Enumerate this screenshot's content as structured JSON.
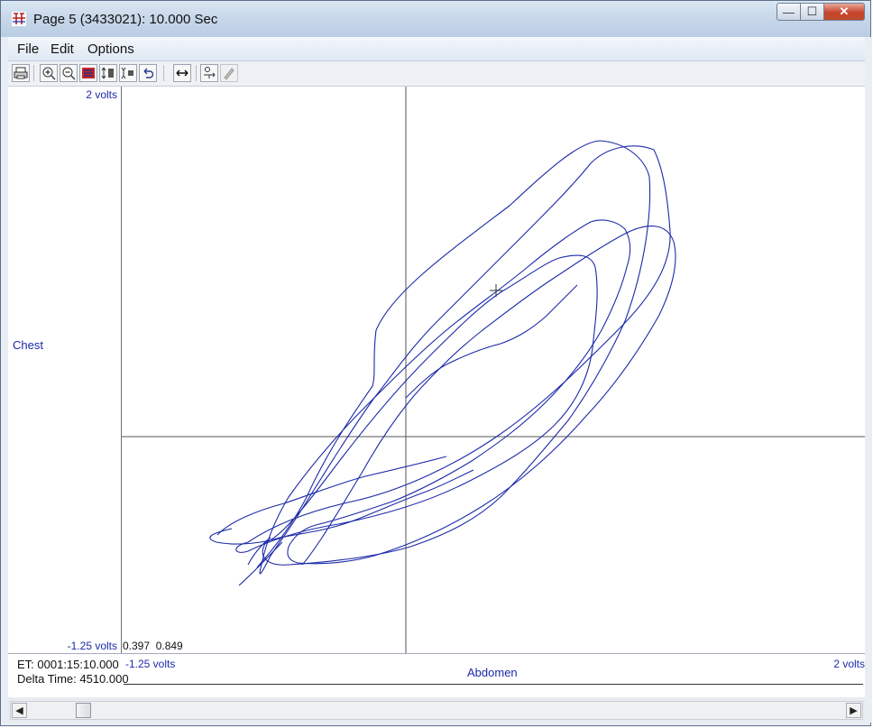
{
  "window": {
    "title": "Page 5 (3433021): 10.000 Sec",
    "min_glyph": "—",
    "max_glyph": "☐",
    "close_glyph": "✕"
  },
  "menu": {
    "file": "File",
    "edit": "Edit",
    "options": "Options"
  },
  "toolbar": {
    "buttons": [
      "print-icon",
      "zoom-in-icon",
      "zoom-out-icon",
      "highlight-icon",
      "expand-vertical-icon",
      "shrink-vertical-icon",
      "undo-icon",
      "horizontal-arrows-icon",
      "settings-icon",
      "pen-icon"
    ]
  },
  "plot": {
    "y_max_label": "2 volts",
    "y_axis_label": "Chest",
    "y_min_label": "-1.25 volts",
    "x_min_label": "-1.25 volts",
    "x_axis_label": "Abdomen",
    "x_max_label": "2 volts",
    "cursor_x": "0.397",
    "cursor_y": "0.849",
    "trace_color": "#1c2aa8",
    "crosshair_color": "#555555"
  },
  "footer": {
    "et": "ET: 0001:15:10.000",
    "delta_time": "Delta Time: 4510.000"
  },
  "scroll": {
    "left_arrow": "◀",
    "right_arrow": "▶"
  }
}
